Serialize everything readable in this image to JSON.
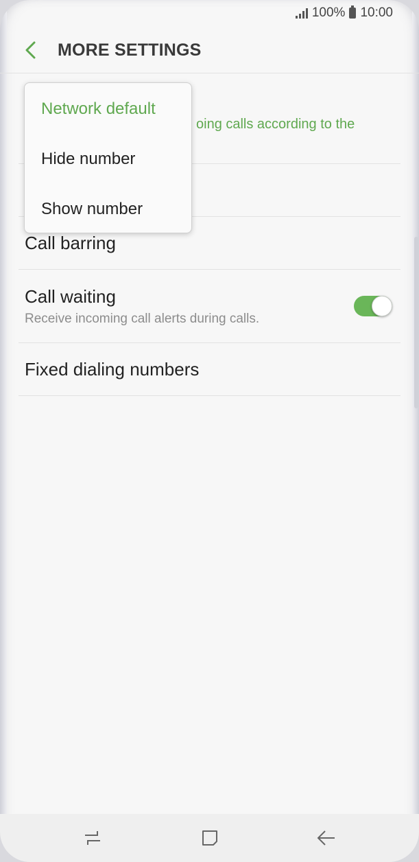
{
  "status": {
    "battery_percent": "100%",
    "time": "10:00"
  },
  "header": {
    "title": "MORE SETTINGS"
  },
  "list": {
    "caller_id_sub": "oing calls according to the",
    "call_barring": "Call barring",
    "call_waiting": {
      "label": "Call waiting",
      "sub": "Receive incoming call alerts during calls.",
      "enabled": true
    },
    "fixed_dialing": "Fixed dialing numbers"
  },
  "dropdown": {
    "options": [
      {
        "label": "Network default",
        "selected": true
      },
      {
        "label": "Hide number",
        "selected": false
      },
      {
        "label": "Show number",
        "selected": false
      }
    ]
  },
  "colors": {
    "accent": "#5fa84f",
    "toggle_on": "#6ab659"
  },
  "icons": {
    "back": "chevron-left-icon",
    "recent": "recent-apps-icon",
    "home": "home-icon",
    "nav_back": "back-arrow-icon"
  }
}
